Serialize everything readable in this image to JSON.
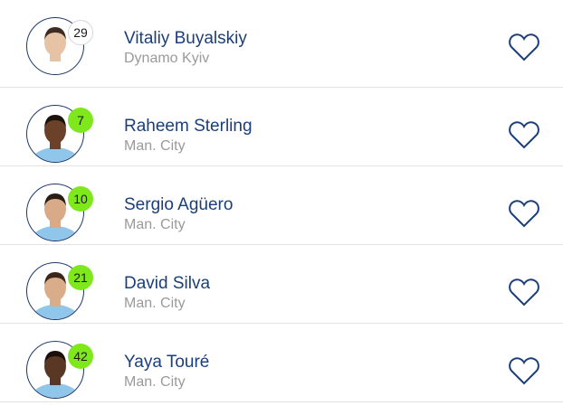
{
  "players": [
    {
      "name": "Vitaliy Buyalskiy",
      "club": "Dynamo Kyiv",
      "number": "29",
      "badge_color": "#ffffff",
      "skin": "#e7c3a5",
      "hair": "#3d2c21",
      "shirt": "#ffffff"
    },
    {
      "name": "Raheem Sterling",
      "club": "Man. City",
      "number": "7",
      "badge_color": "#7ee81d",
      "skin": "#6b4129",
      "hair": "#1d120c",
      "shirt": "#8fc6ea"
    },
    {
      "name": "Sergio Agüero",
      "club": "Man. City",
      "number": "10",
      "badge_color": "#7ee81d",
      "skin": "#d8aa88",
      "hair": "#2a1d16",
      "shirt": "#8fc6ea"
    },
    {
      "name": "David Silva",
      "club": "Man. City",
      "number": "21",
      "badge_color": "#7ee81d",
      "skin": "#d9ad8a",
      "hair": "#3a261a",
      "shirt": "#8fc6ea"
    },
    {
      "name": "Yaya Touré",
      "club": "Man. City",
      "number": "42",
      "badge_color": "#7ee81d",
      "skin": "#5a3624",
      "hair": "#1a0f0a",
      "shirt": "#8fc6ea"
    }
  ],
  "favorite_icon": "heart-outline-icon",
  "colors": {
    "name": "#1b3f7a",
    "club": "#9a9a9a",
    "accent": "#7ee81d",
    "heart": "#1b3f7a"
  }
}
